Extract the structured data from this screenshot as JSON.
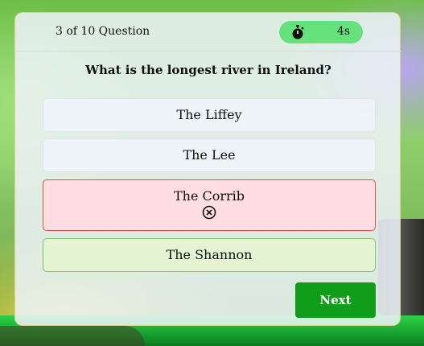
{
  "header": {
    "counter": "3 of 10 Question",
    "timer": "4s"
  },
  "question": "What is the longest river in Ireland?",
  "options": [
    {
      "label": "The Liffey",
      "state": "neutral"
    },
    {
      "label": "The Lee",
      "state": "neutral"
    },
    {
      "label": "The Corrib",
      "state": "wrong"
    },
    {
      "label": "The Shannon",
      "state": "correct"
    }
  ],
  "next_label": "Next",
  "icons": {
    "timer": "stopwatch-icon",
    "wrong": "circle-x-icon"
  },
  "colors": {
    "timer_bg": "#66e27d",
    "wrong_bg": "#ffdde0",
    "wrong_border": "#d9534f",
    "correct_bg": "#e5f5d4",
    "next_bg": "#0f9d1a"
  }
}
